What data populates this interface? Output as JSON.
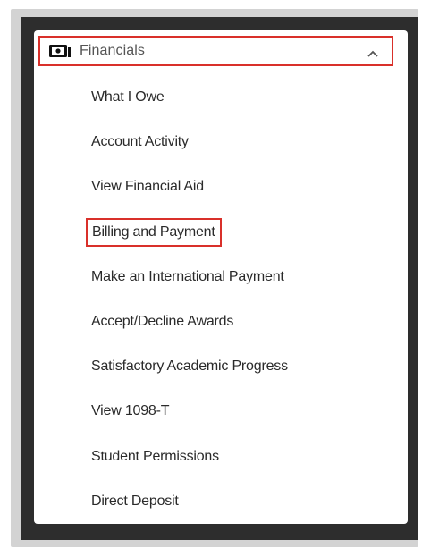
{
  "menu": {
    "header": {
      "label": "Financials",
      "icon": "money-icon",
      "expanded_icon": "chevron-up-icon",
      "highlight_color": "#d9302a"
    },
    "items": [
      {
        "label": "What I Owe"
      },
      {
        "label": "Account Activity"
      },
      {
        "label": "View Financial Aid"
      },
      {
        "label": "Billing and Payment",
        "highlighted": true
      },
      {
        "label": "Make an International Payment"
      },
      {
        "label": "Accept/Decline Awards"
      },
      {
        "label": "Satisfactory Academic Progress"
      },
      {
        "label": "View 1098-T"
      },
      {
        "label": "Student Permissions"
      },
      {
        "label": "Direct Deposit"
      }
    ]
  }
}
